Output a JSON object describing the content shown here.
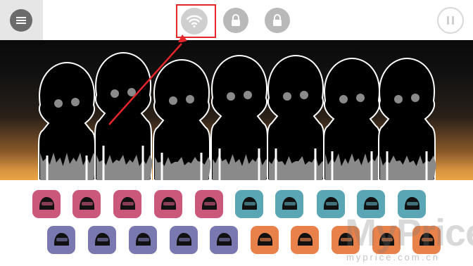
{
  "toolbar": {
    "menu_icon": "hamburger-icon",
    "wifi_icon": "wifi-icon",
    "lock_icon": "lock-icon",
    "pause_icon": "pause-icon"
  },
  "stage": {
    "character_count": 7
  },
  "palette": {
    "row1": [
      {
        "name": "helmet-sound",
        "color": "#c9587a"
      },
      {
        "name": "goggles-sound",
        "color": "#c9587a"
      },
      {
        "name": "visor-sound",
        "color": "#c9587a"
      },
      {
        "name": "cube-sound",
        "color": "#c9587a"
      },
      {
        "name": "robot-head-sound",
        "color": "#c9587a"
      },
      {
        "name": "mask-sound",
        "color": "#5aa6b4"
      },
      {
        "name": "glasses-sound",
        "color": "#5aa6b4"
      },
      {
        "name": "headphones-sound",
        "color": "#5aa6b4"
      },
      {
        "name": "headset-sound",
        "color": "#5aa6b4"
      },
      {
        "name": "grid-mask-sound",
        "color": "#5aa6b4"
      }
    ],
    "row2": [
      {
        "name": "gas-mask-sound",
        "color": "#7a78b0"
      },
      {
        "name": "face-plate-sound",
        "color": "#7a78b0"
      },
      {
        "name": "robot-mask-sound",
        "color": "#7a78b0"
      },
      {
        "name": "round-glasses-sound",
        "color": "#7a78b0"
      },
      {
        "name": "hat-sound",
        "color": "#7a78b0"
      },
      {
        "name": "gear-sound",
        "color": "#e8814a"
      },
      {
        "name": "bandana-sound",
        "color": "#e8814a"
      },
      {
        "name": "cap-sound",
        "color": "#e8814a"
      },
      {
        "name": "stick-sound",
        "color": "#e8814a"
      },
      {
        "name": "shades-sound",
        "color": "#e8814a"
      }
    ]
  },
  "watermark": {
    "brand": "MyPrice",
    "url": "myprice.com.cn"
  }
}
